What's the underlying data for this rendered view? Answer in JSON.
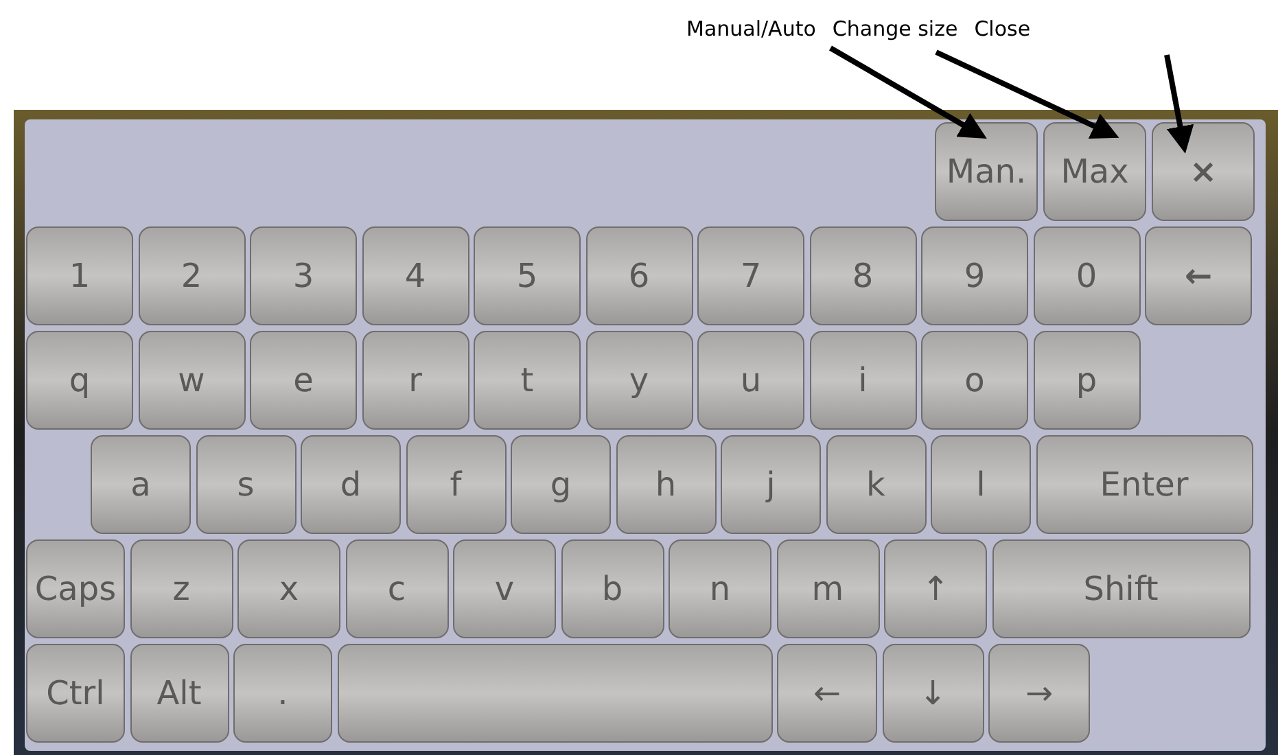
{
  "annotations": [
    {
      "label": "Manual/Auto"
    },
    {
      "label": "Change size"
    },
    {
      "label": "Close"
    }
  ],
  "toolbar": [
    {
      "label": "Man."
    },
    {
      "label": "Max"
    },
    {
      "label": "×",
      "kind": "icon"
    }
  ],
  "rows": [
    {
      "keys": [
        {
          "label": "1"
        },
        {
          "label": "2"
        },
        {
          "label": "3"
        },
        {
          "label": "4"
        },
        {
          "label": "5"
        },
        {
          "label": "6"
        },
        {
          "label": "7"
        },
        {
          "label": "8"
        },
        {
          "label": "9"
        },
        {
          "label": "0"
        },
        {
          "label": "←",
          "kind": "icon"
        }
      ]
    },
    {
      "keys": [
        {
          "label": "q"
        },
        {
          "label": "w"
        },
        {
          "label": "e"
        },
        {
          "label": "r"
        },
        {
          "label": "t"
        },
        {
          "label": "y"
        },
        {
          "label": "u"
        },
        {
          "label": "i"
        },
        {
          "label": "o"
        },
        {
          "label": "p"
        }
      ]
    },
    {
      "keys": [
        {
          "label": "a"
        },
        {
          "label": "s"
        },
        {
          "label": "d"
        },
        {
          "label": "f"
        },
        {
          "label": "g"
        },
        {
          "label": "h"
        },
        {
          "label": "j"
        },
        {
          "label": "k"
        },
        {
          "label": "l"
        },
        {
          "label": "Enter"
        }
      ]
    },
    {
      "keys": [
        {
          "label": "Caps"
        },
        {
          "label": "z"
        },
        {
          "label": "x"
        },
        {
          "label": "c"
        },
        {
          "label": "v"
        },
        {
          "label": "b"
        },
        {
          "label": "n"
        },
        {
          "label": "m"
        },
        {
          "label": "↑"
        },
        {
          "label": "Shift"
        }
      ]
    },
    {
      "keys": [
        {
          "label": "Ctrl"
        },
        {
          "label": "Alt"
        },
        {
          "label": "."
        },
        {
          "kind": "space"
        },
        {
          "label": "←"
        },
        {
          "label": "↓"
        },
        {
          "label": "→"
        }
      ]
    }
  ]
}
